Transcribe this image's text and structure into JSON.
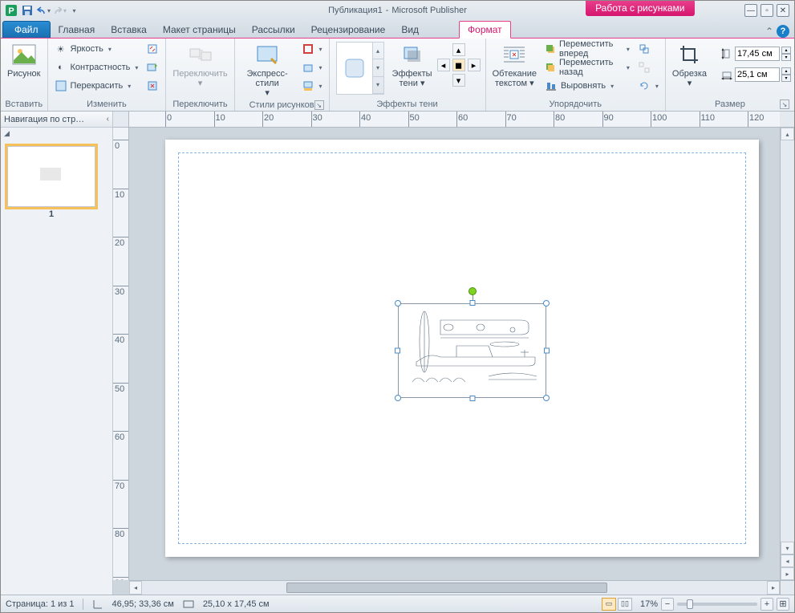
{
  "title": {
    "doc": "Публикация1",
    "app": "Microsoft Publisher",
    "sep": "-"
  },
  "context_tab": "Работа с рисунками",
  "tabs": {
    "file": "Файл",
    "items": [
      "Главная",
      "Вставка",
      "Макет страницы",
      "Рассылки",
      "Рецензирование",
      "Вид"
    ],
    "format": "Формат"
  },
  "ribbon": {
    "insert": {
      "picture": "Рисунок",
      "label": "Вставить"
    },
    "adjust": {
      "brightness": "Яркость",
      "contrast": "Контрастность",
      "recolor": "Перекрасить",
      "label": "Изменить"
    },
    "swap": {
      "btn": "Переключить",
      "label": "Переключить"
    },
    "styles": {
      "btn": "Экспресс-стили",
      "label": "Стили рисунков"
    },
    "shadow": {
      "btn": "Эффекты\nтени",
      "label": "Эффекты тени"
    },
    "arrange": {
      "wrap": "Обтекание\nтекстом",
      "forward": "Переместить вперед",
      "backward": "Переместить назад",
      "align": "Выровнять",
      "label": "Упорядочить"
    },
    "crop": {
      "btn": "Обрезка"
    },
    "size": {
      "height": "17,45 см",
      "width": "25,1 см",
      "label": "Размер"
    }
  },
  "nav": {
    "title": "Навигация по стр…",
    "page": "1"
  },
  "status": {
    "page": "Страница: 1 из 1",
    "pos": "46,95; 33,36 см",
    "dim": "25,10 x 17,45 см",
    "zoom": "17%"
  }
}
